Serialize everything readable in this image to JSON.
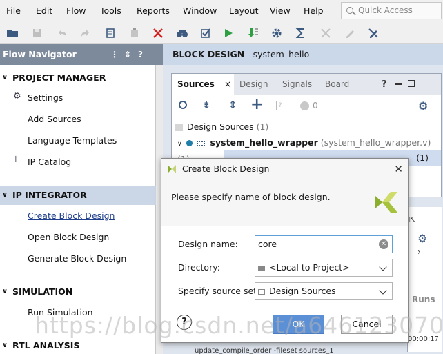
{
  "menubar": {
    "items": [
      "File",
      "Edit",
      "Flow",
      "Tools",
      "Reports",
      "Window",
      "Layout",
      "View",
      "Help"
    ],
    "quick_access_placeholder": "Quick Access"
  },
  "flow_navigator": {
    "title": "Flow Navigator",
    "controls": [
      "⋮",
      "⇕",
      "?"
    ],
    "sections": [
      {
        "label": "PROJECT MANAGER",
        "items": [
          "Settings",
          "Add Sources",
          "Language Templates",
          "IP Catalog"
        ]
      },
      {
        "label": "IP INTEGRATOR",
        "items": [
          "Create Block Design",
          "Open Block Design",
          "Generate Block Design"
        ]
      },
      {
        "label": "SIMULATION",
        "items": [
          "Run Simulation"
        ]
      },
      {
        "label": "RTL ANALYSIS",
        "items": []
      }
    ]
  },
  "block_design": {
    "title_bold": "BLOCK DESIGN",
    "title_rest": " - system_hello"
  },
  "sources": {
    "tabs": [
      "Sources",
      "Design",
      "Signals",
      "Board"
    ],
    "tab_close": "×",
    "count": "0",
    "group_label": "Design Sources",
    "group_count": "(1)",
    "wrapper_name": "system_hello_wrapper",
    "wrapper_file": "(system_hello_wrapper.v) (1)",
    "child_count": "(1)"
  },
  "lower_panel": {
    "runs_tab": "Runs",
    "time": "00:00:17",
    "console_line": "update_compile_order -fileset sources_1"
  },
  "dialog": {
    "title": "Create Block Design",
    "prompt": "Please specify name of block design.",
    "design_name_label": "Design name:",
    "design_name_value": "core",
    "directory_label": "Directory:",
    "directory_value": "<Local to Project>",
    "source_set_label": "Specify source set:",
    "source_set_value": "Design Sources",
    "help_label": "?",
    "ok_label": "OK",
    "cancel_label": "Cancel",
    "close_glyph": "✕"
  },
  "watermark": "https://blog.csdn.net/a646123070",
  "colors": {
    "nav_header": "#7c8a9c",
    "accent_blue": "#5b8fd6",
    "active_section": "#cbd6e6",
    "run_green": "#2ea043",
    "stop_red": "#d42020"
  }
}
